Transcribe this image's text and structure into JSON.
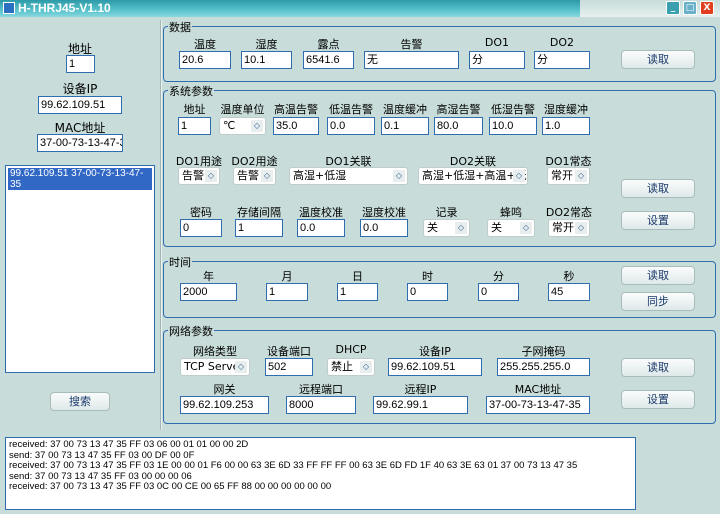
{
  "window": {
    "title": "H-THRJ45-V1.10",
    "minimize": "_",
    "maximize": "□",
    "close": "X"
  },
  "left": {
    "addr_label": "地址",
    "addr": "1",
    "ip_label": "设备IP",
    "ip": "99.62.109.51",
    "mac_label": "MAC地址",
    "mac": "37-00-73-13-47-35",
    "devices": [
      "99.62.109.51 37-00-73-13-47-35"
    ],
    "search": "搜索"
  },
  "data": {
    "title": "数据",
    "fields": [
      {
        "label": "温度",
        "value": "20.6"
      },
      {
        "label": "湿度",
        "value": "10.1"
      },
      {
        "label": "露点",
        "value": "6541.6"
      },
      {
        "label": "告警",
        "value": "无"
      },
      {
        "label": "DO1",
        "value": "分"
      },
      {
        "label": "DO2",
        "value": "分"
      }
    ],
    "read": "读取"
  },
  "sys": {
    "title": "系统参数",
    "row1": [
      {
        "label": "地址",
        "value": "1"
      },
      {
        "label": "温度单位",
        "value": "℃"
      },
      {
        "label": "高温告警",
        "value": "35.0"
      },
      {
        "label": "低温告警",
        "value": "0.0"
      },
      {
        "label": "温度缓冲",
        "value": "0.1"
      },
      {
        "label": "高湿告警",
        "value": "80.0"
      },
      {
        "label": "低湿告警",
        "value": "10.0"
      },
      {
        "label": "湿度缓冲",
        "value": "1.0"
      }
    ],
    "row2": [
      {
        "label": "DO1用途",
        "value": "告警"
      },
      {
        "label": "DO2用途",
        "value": "告警"
      },
      {
        "label": "DO1关联",
        "value": "高湿+低湿"
      },
      {
        "label": "DO2关联",
        "value": "高湿+低湿+高温+低温"
      },
      {
        "label": "DO1常态",
        "value": "常开"
      }
    ],
    "row3": [
      {
        "label": "密码",
        "value": "0"
      },
      {
        "label": "存储间隔",
        "value": "1"
      },
      {
        "label": "温度校准",
        "value": "0.0"
      },
      {
        "label": "湿度校准",
        "value": "0.0"
      },
      {
        "label": "记录",
        "value": "关"
      },
      {
        "label": "蜂鸣",
        "value": "关"
      },
      {
        "label": "DO2常态",
        "value": "常开"
      }
    ],
    "read": "读取",
    "set": "设置"
  },
  "time": {
    "title": "时间",
    "fields": [
      {
        "label": "年",
        "value": "2000"
      },
      {
        "label": "月",
        "value": "1"
      },
      {
        "label": "日",
        "value": "1"
      },
      {
        "label": "时",
        "value": "0"
      },
      {
        "label": "分",
        "value": "0"
      },
      {
        "label": "秒",
        "value": "45"
      }
    ],
    "read": "读取",
    "sync": "同步"
  },
  "net": {
    "title": "网络参数",
    "row1": [
      {
        "label": "网络类型",
        "value": "TCP Server"
      },
      {
        "label": "设备端口",
        "value": "502"
      },
      {
        "label": "DHCP",
        "value": "禁止"
      },
      {
        "label": "设备IP",
        "value": "99.62.109.51"
      },
      {
        "label": "子网掩码",
        "value": "255.255.255.0"
      }
    ],
    "row2": [
      {
        "label": "网关",
        "value": "99.62.109.253"
      },
      {
        "label": "远程端口",
        "value": "8000"
      },
      {
        "label": "远程IP",
        "value": "99.62.99.1"
      },
      {
        "label": "MAC地址",
        "value": "37-00-73-13-47-35"
      }
    ],
    "read": "读取",
    "set": "设置"
  },
  "log": [
    "received: 37 00 73 13 47 35 FF 03 06 00 01 01 00 00 2D",
    "send: 37 00 73 13 47 35 FF 03 00 DF 00 0F",
    "received: 37 00 73 13 47 35 FF 03 1E 00 00 01 F6 00 00 63 3E 6D 33 FF FF FF 00 63 3E 6D FD 1F 40 63 3E 63 01 37 00 73 13 47 35",
    "send:  37 00 73 13 47 35 FF 03 00 00 00 06",
    "received:  37 00 73 13 47 35 FF 03 0C 00 CE 00 65 FF 88 00 00 00 00 00 00"
  ]
}
